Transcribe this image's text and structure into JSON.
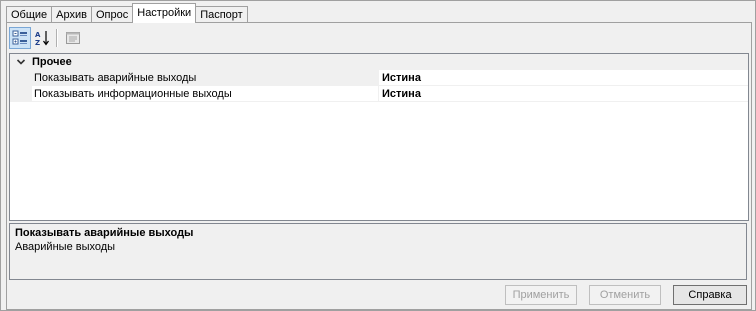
{
  "tabs": [
    {
      "label": "Общие"
    },
    {
      "label": "Архив"
    },
    {
      "label": "Опрос"
    },
    {
      "label": "Настройки"
    },
    {
      "label": "Паспорт"
    }
  ],
  "active_tab": "Настройки",
  "toolbar": {
    "categorized_icon": "categorized-view-icon",
    "alphabetical_icon": "alphabetical-sort-icon",
    "property_pages_icon": "property-pages-icon"
  },
  "grid": {
    "category": "Прочее",
    "properties": [
      {
        "name": "Показывать аварийные выходы",
        "value": "Истина"
      },
      {
        "name": "Показывать информационные выходы",
        "value": "Истина"
      }
    ]
  },
  "description": {
    "title": "Показывать аварийные выходы",
    "text": "Аварийные выходы"
  },
  "buttons": {
    "apply": "Применить",
    "cancel": "Отменить",
    "help": "Справка"
  }
}
